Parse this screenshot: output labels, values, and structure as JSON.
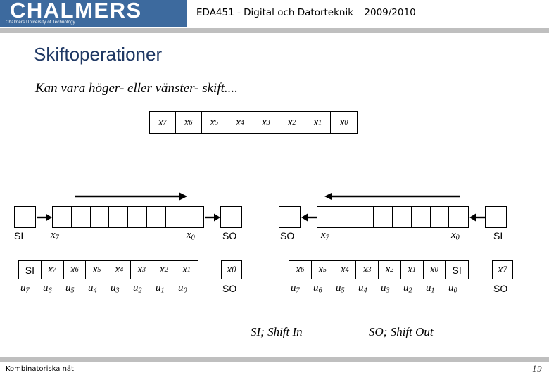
{
  "header": {
    "logo_wordmark": "CHALMERS",
    "logo_tagline": "Chalmers University of Technology",
    "course_title": "EDA451 - Digital och Datorteknik – 2009/2010",
    "logo_bg_color": "#3d6a9e",
    "rule_color": "#bfbfbf"
  },
  "slide": {
    "title": "Skiftoperationer",
    "title_color": "#1f3864",
    "subtitle": "Kan vara höger- eller vänster- skift...."
  },
  "register_top": {
    "name": "x-register",
    "cells": [
      "x7",
      "x6",
      "x5",
      "x4",
      "x3",
      "x2",
      "x1",
      "x0"
    ]
  },
  "left_diagram": {
    "shift_direction": "right",
    "input_box_label": "SI",
    "output_box_label": "SO",
    "msb_label": "x7",
    "lsb_label": "x0",
    "register_cell_count": 8
  },
  "right_diagram": {
    "shift_direction": "left",
    "input_box_label": "SI",
    "output_box_label": "SO",
    "msb_label": "x7",
    "lsb_label": "x0",
    "register_cell_count": 8
  },
  "left_result": {
    "top_cells": [
      "SI",
      "x7",
      "x6",
      "x5",
      "x4",
      "x3",
      "x2",
      "x1"
    ],
    "spill_cell": "x0",
    "bottom_labels": [
      "u7",
      "u6",
      "u5",
      "u4",
      "u3",
      "u2",
      "u1",
      "u0"
    ],
    "spill_label": "SO"
  },
  "right_result": {
    "top_cells": [
      "x6",
      "x5",
      "x4",
      "x3",
      "x2",
      "x1",
      "x0",
      "SI"
    ],
    "spill_cell": "x7",
    "bottom_labels": [
      "u7",
      "u6",
      "u5",
      "u4",
      "u3",
      "u2",
      "u1",
      "u0"
    ],
    "spill_label": "SO"
  },
  "captions": {
    "shift_in": "SI; Shift In",
    "shift_out": "SO; Shift Out"
  },
  "footer": {
    "section": "Kombinatoriska nät",
    "page_number": "19"
  }
}
